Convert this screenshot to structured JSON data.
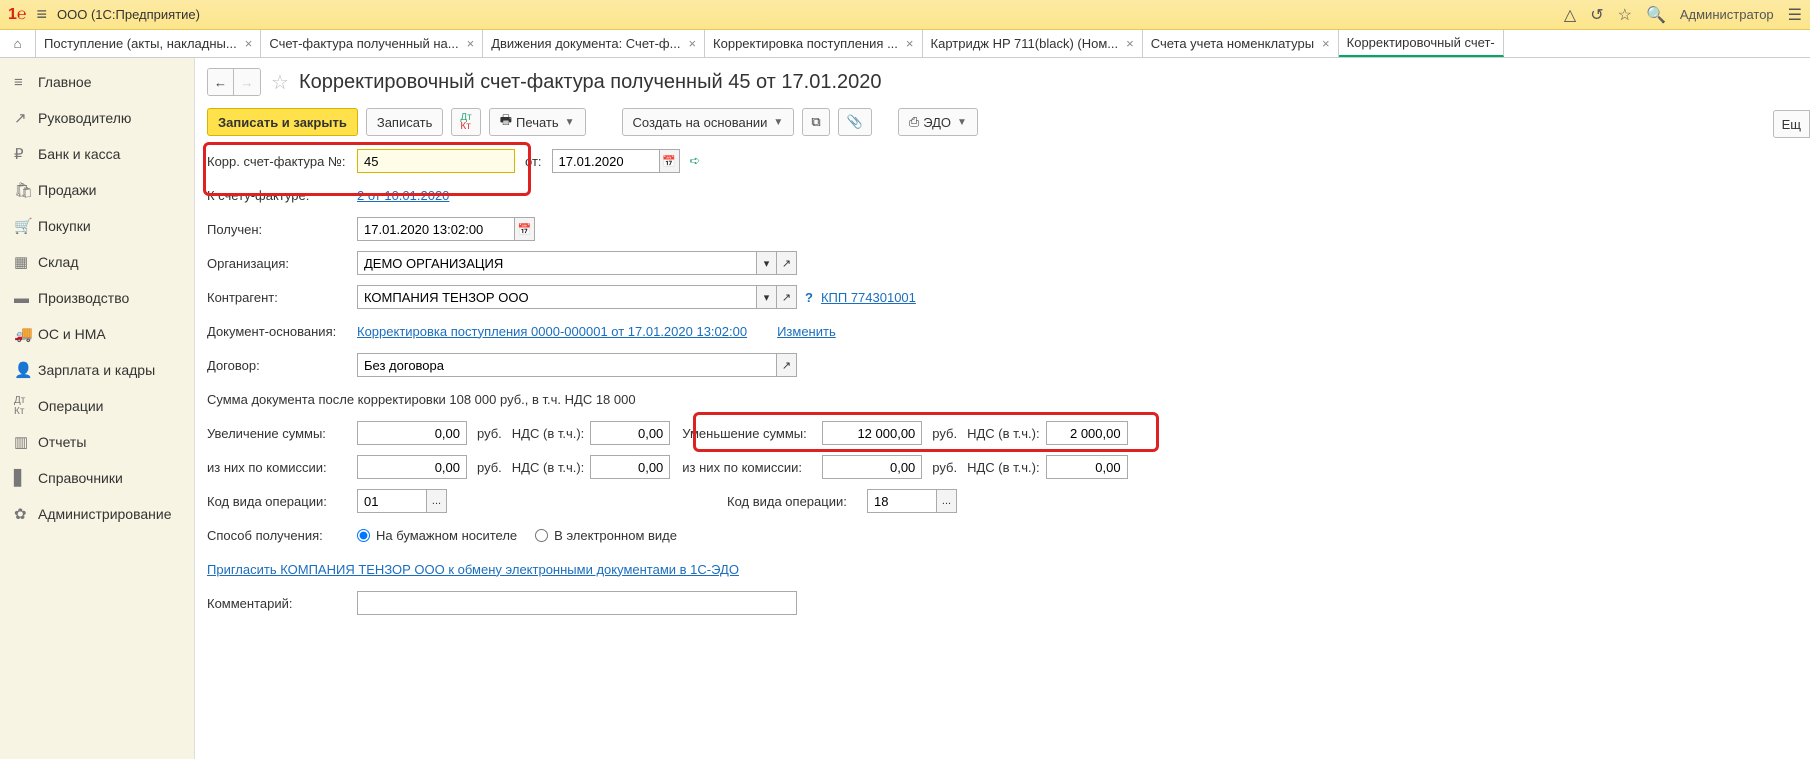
{
  "titlebar": {
    "company": "ООО  (1С:Предприятие)",
    "user": "Администратор"
  },
  "tabs": [
    {
      "label": "Поступление (акты, накладны..."
    },
    {
      "label": "Счет-фактура полученный на..."
    },
    {
      "label": "Движения документа: Счет-ф..."
    },
    {
      "label": "Корректировка поступления ..."
    },
    {
      "label": "Картридж HP 711(black) (Ном..."
    },
    {
      "label": "Счета учета номенклатуры"
    },
    {
      "label": "Корректировочный счет-"
    }
  ],
  "sidebar": [
    {
      "icon": "≡",
      "label": "Главное"
    },
    {
      "icon": "↗",
      "label": "Руководителю"
    },
    {
      "icon": "₽",
      "label": "Банк и касса"
    },
    {
      "icon": "🛍",
      "label": "Продажи"
    },
    {
      "icon": "🛒",
      "label": "Покупки"
    },
    {
      "icon": "▦",
      "label": "Склад"
    },
    {
      "icon": "🏭",
      "label": "Производство"
    },
    {
      "icon": "🚚",
      "label": "ОС и НМА"
    },
    {
      "icon": "👤",
      "label": "Зарплата и кадры"
    },
    {
      "icon": "Дт",
      "label": "Операции"
    },
    {
      "icon": "▥",
      "label": "Отчеты"
    },
    {
      "icon": "▋",
      "label": "Справочники"
    },
    {
      "icon": "✿",
      "label": "Администрирование"
    }
  ],
  "doctitle": "Корректировочный счет-фактура полученный 45 от 17.01.2020",
  "toolbar": {
    "save_close": "Записать и закрыть",
    "save": "Записать",
    "print": "Печать",
    "create_based": "Создать на основании",
    "edo": "ЭДО",
    "more": "Ещ"
  },
  "form": {
    "num_label": "Корр. счет-фактура №:",
    "num_value": "45",
    "date_label": "от:",
    "date_value": "17.01.2020",
    "invoice_label": "К счету-фактуре:",
    "invoice_link": "2 от 10.01.2020",
    "received_label": "Получен:",
    "received_value": "17.01.2020 13:02:00",
    "org_label": "Организация:",
    "org_value": "ДЕМО ОРГАНИЗАЦИЯ",
    "contr_label": "Контрагент:",
    "contr_value": "КОМПАНИЯ ТЕНЗОР ООО",
    "kpp_link": "КПП 774301001",
    "basis_label": "Документ-основания:",
    "basis_link": "Корректировка поступления 0000-000001 от 17.01.2020 13:02:00",
    "change_link": "Изменить",
    "contract_label": "Договор:",
    "contract_value": "Без договора",
    "sum_text": "Сумма документа после корректировки 108 000 руб., в т.ч. НДС 18 000",
    "inc_label": "Увеличение суммы:",
    "inc_val": "0,00",
    "rub": "руб.",
    "nds_label": "НДС (в т.ч.):",
    "inc_nds": "0,00",
    "dec_label": "Уменьшение суммы:",
    "dec_val": "12 000,00",
    "dec_nds": "2 000,00",
    "comm_inc_label": "из них по комиссии:",
    "comm_inc_val": "0,00",
    "comm_inc_nds": "0,00",
    "comm_dec_label": "из них по комиссии:",
    "comm_dec_val": "0,00",
    "comm_dec_nds": "0,00",
    "opcode_label": "Код вида операции:",
    "opcode1": "01",
    "opcode2": "18",
    "method_label": "Способ получения:",
    "radio1": "На бумажном носителе",
    "radio2": "В электронном виде",
    "invite_link": "Пригласить КОМПАНИЯ ТЕНЗОР ООО к обмену электронными документами в 1С-ЭДО",
    "comment_label": "Комментарий:"
  }
}
